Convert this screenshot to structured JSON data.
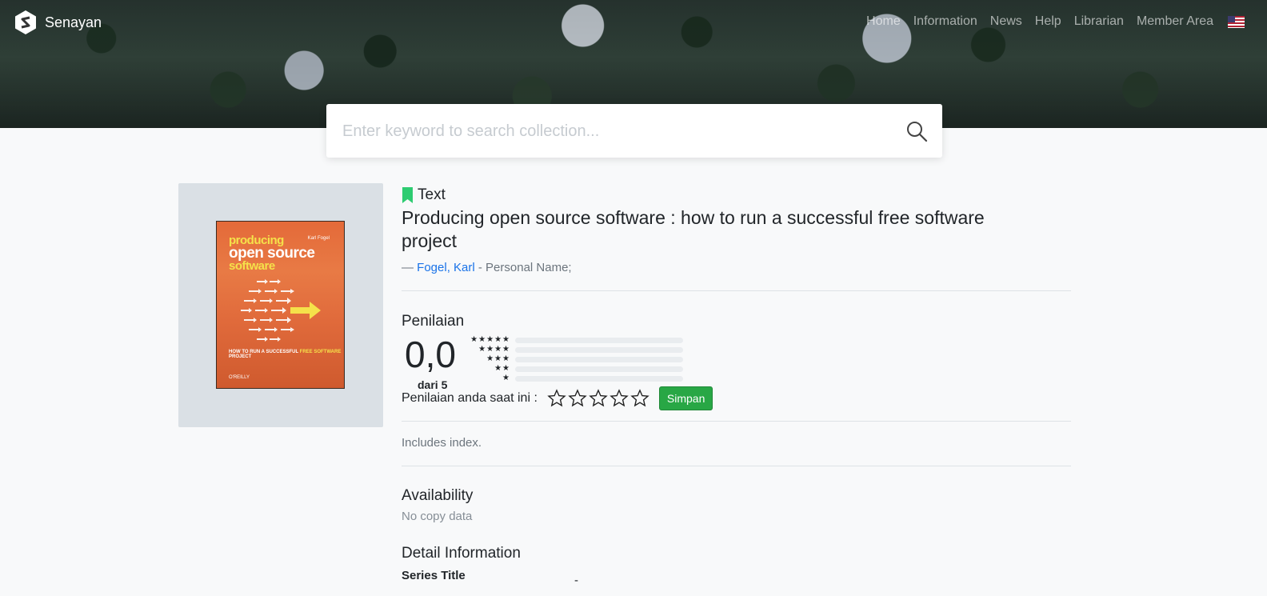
{
  "brand": {
    "name": "Senayan"
  },
  "nav": {
    "items": [
      "Home",
      "Information",
      "News",
      "Help",
      "Librarian",
      "Member Area"
    ]
  },
  "search": {
    "placeholder": "Enter keyword to search collection..."
  },
  "cover": {
    "title_line1": "producing",
    "title_line2": "open source",
    "title_line3": "software",
    "author": "Karl Fogel",
    "subtitle_pre": "HOW TO RUN A SUCCESSFUL ",
    "subtitle_hl": "FREE SOFTWARE",
    "subtitle_post": " PROJECT",
    "publisher": "O'REILLY"
  },
  "item": {
    "type": "Text",
    "title": "Producing open source software : how to run a successful free software project",
    "author_prefix": "— ",
    "author": "Fogel, Karl",
    "author_role": " - Personal Name;"
  },
  "rating": {
    "heading": "Penilaian",
    "score": "0,0",
    "score_sub": "dari 5",
    "distribution": [
      {
        "stars": "★★★★★",
        "fraction": 0
      },
      {
        "stars": "★★★★",
        "fraction": 0
      },
      {
        "stars": "★★★",
        "fraction": 0
      },
      {
        "stars": "★★",
        "fraction": 0
      },
      {
        "stars": "★",
        "fraction": 0
      }
    ],
    "current_label": "Penilaian anda saat ini :",
    "current_value": 0,
    "save_label": "Simpan"
  },
  "notes": "Includes index.",
  "availability": {
    "heading": "Availability",
    "value": "No copy data"
  },
  "detail": {
    "heading": "Detail Information",
    "first_label": "Series Title",
    "first_value": "-"
  },
  "colors": {
    "accent_green": "#28a745",
    "link": "#1a73e8",
    "bookmark": "#2ecc71"
  }
}
